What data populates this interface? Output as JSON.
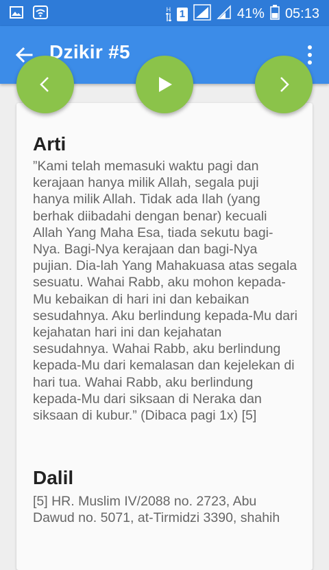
{
  "status_bar": {
    "battery_percent": "41%",
    "time": "05:13",
    "sim_slot": "1",
    "network_h": "H",
    "icons": [
      "image-icon",
      "wifi-icon",
      "data-arrows-icon",
      "signal-icon",
      "battery-icon"
    ]
  },
  "app_bar": {
    "title": "Dzikir #5",
    "back_icon": "arrow-back-icon",
    "menu_icon": "more-vert-icon",
    "color": "#3c8ce8"
  },
  "controls": {
    "prev_icon": "chevron-left-icon",
    "play_icon": "play-icon",
    "next_icon": "chevron-right-icon",
    "color": "#8bc34a"
  },
  "content": {
    "arti_title": "Arti",
    "arti_text": "”Kami telah memasuki waktu pagi dan kerajaan hanya milik Allah, segala puji hanya milik Allah. Tidak ada Ilah (yang berhak diibadahi dengan benar) kecuali Allah Yang Maha Esa, tiada sekutu bagi-Nya. Bagi-Nya kerajaan dan bagi-Nya pujian. Dia-lah Yang Mahakuasa atas segala sesuatu. Wahai Rabb, aku mohon kepada-Mu kebaikan di hari ini dan kebaikan sesudahnya. Aku berlindung kepada-Mu dari kejahatan hari ini dan kejahatan sesudahnya. Wahai Rabb, aku berlindung kepada-Mu dari kemalasan dan kejelekan di hari tua. Wahai Rabb, aku berlindung kepada-Mu dari siksaan di Neraka dan siksaan di kubur.” (Dibaca pagi 1x) [5]",
    "dalil_title": "Dalil",
    "dalil_text": "[5] HR. Muslim IV/2088 no. 2723, Abu Dawud no. 5071, at-Tirmidzi 3390, shahih"
  }
}
